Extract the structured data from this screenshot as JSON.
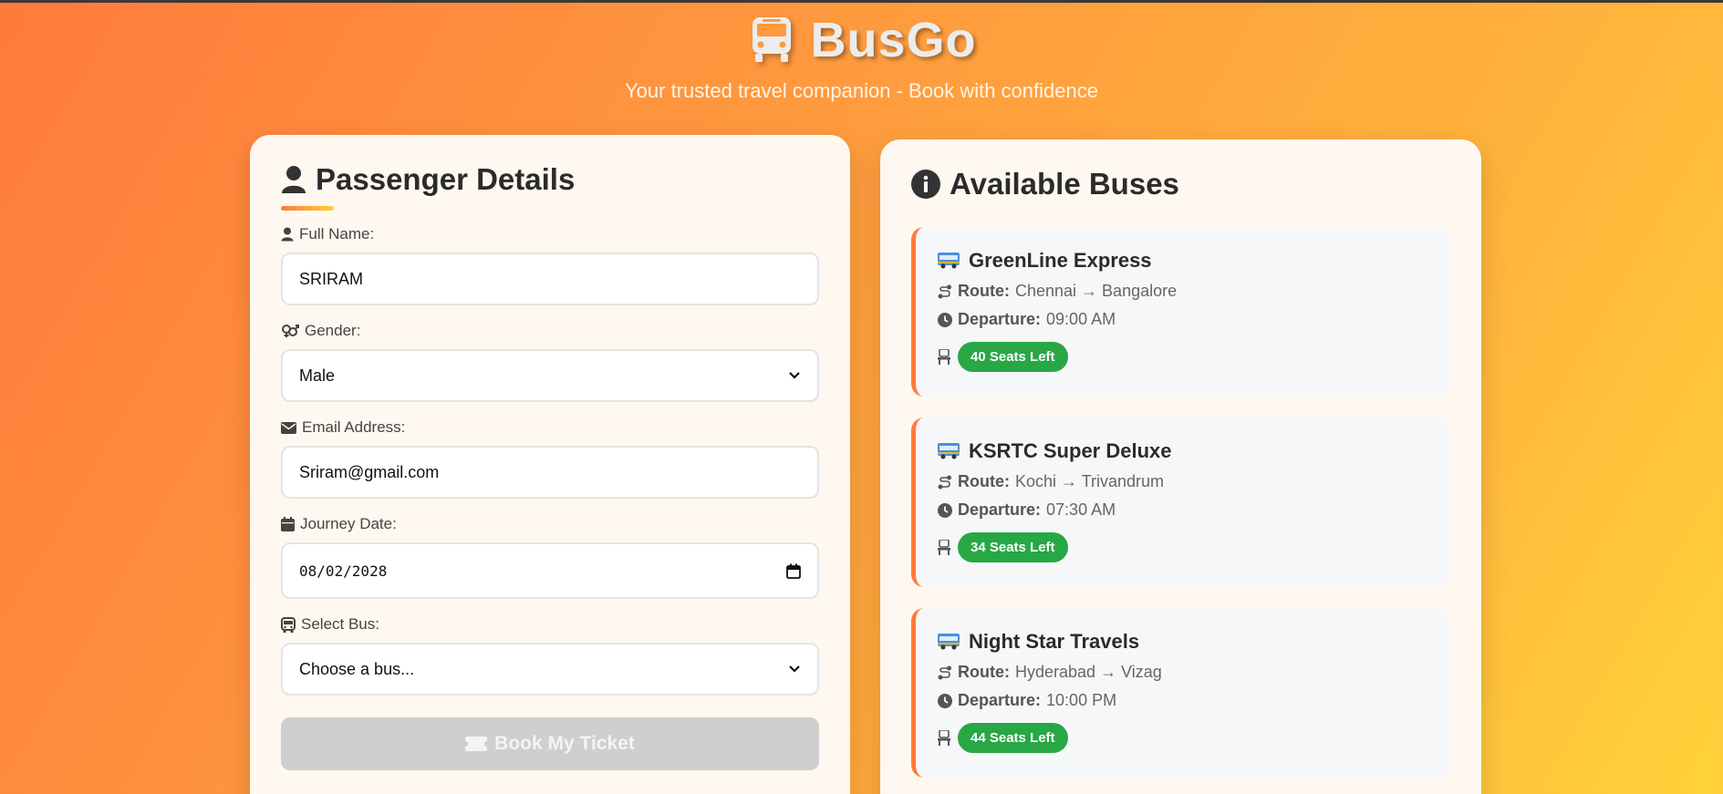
{
  "header": {
    "brand": "BusGo",
    "tagline": "Your trusted travel companion - Book with confidence"
  },
  "form": {
    "title": "Passenger Details",
    "fields": {
      "name": {
        "label": "Full Name:",
        "value": "SRIRAM"
      },
      "gender": {
        "label": "Gender:",
        "value": "Male"
      },
      "email": {
        "label": "Email Address:",
        "value": "Sriram@gmail.com"
      },
      "date": {
        "label": "Journey Date:",
        "value": "08/02/2028"
      },
      "bus": {
        "label": "Select Bus:",
        "value": "Choose a bus..."
      }
    },
    "submit_label": "Book My Ticket"
  },
  "buses": {
    "title": "Available Buses",
    "route_label": "Route:",
    "departure_label": "Departure:",
    "items": [
      {
        "name": "GreenLine Express",
        "route": "Chennai → Bangalore",
        "departure": "09:00 AM",
        "seats": "40 Seats Left"
      },
      {
        "name": "KSRTC Super Deluxe",
        "route": "Kochi → Trivandrum",
        "departure": "07:30 AM",
        "seats": "34 Seats Left"
      },
      {
        "name": "Night Star Travels",
        "route": "Hyderabad → Vizag",
        "departure": "10:00 PM",
        "seats": "44 Seats Left"
      }
    ]
  },
  "colors": {
    "accent": "#ff7a3c",
    "badge": "#28a745",
    "disabled_button": "#cfcfcf"
  }
}
